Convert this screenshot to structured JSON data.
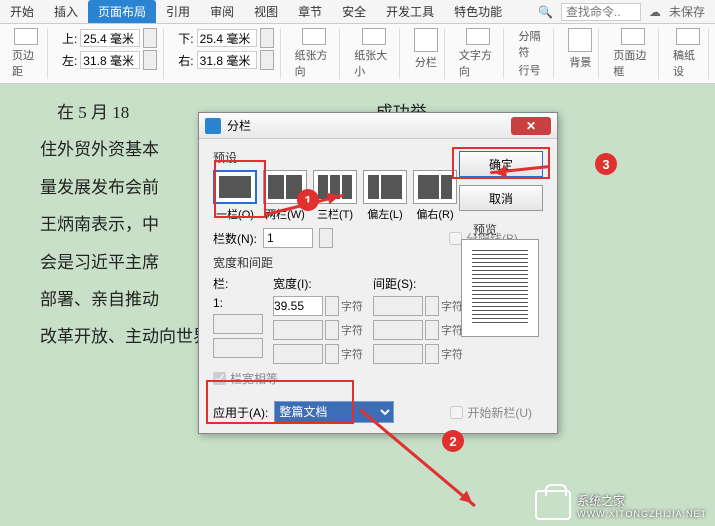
{
  "ribbon": {
    "tabs": [
      "开始",
      "插入",
      "页面布局",
      "引用",
      "审阅",
      "视图",
      "章节",
      "安全",
      "开发工具",
      "特色功能"
    ],
    "active_index": 2,
    "search_placeholder": "查找命令..",
    "unsaved": "未保存"
  },
  "toolbar": {
    "margin_label": "页边距",
    "top_label": "上:",
    "top_value": "25.4 毫米",
    "bottom_label": "下:",
    "bottom_value": "25.4 毫米",
    "left_label": "左:",
    "left_value": "31.8 毫米",
    "right_label": "右:",
    "right_value": "31.8 毫米",
    "orient": "纸张方向",
    "size": "纸张大小",
    "columns": "分栏",
    "direction": "文字方向",
    "break": "分隔符",
    "lineno": "行号",
    "background": "背景",
    "border": "页面边框",
    "manuscript": "稿纸设"
  },
  "document_text": "    在 5 月 18                                                          成功举\n住外贸外资基本                                                    外、投资\n量发展发布会前                                                    和开放\n王炳南表示，中                                                    ，综合\n会是习近平主席                                                    产生了\n部署、亲自推动                                                    的赞誉。\n改革开放、主动向世界开放市场",
  "dialog": {
    "title": "分栏",
    "preset_label": "预设",
    "presets": [
      "一栏(O)",
      "两栏(W)",
      "三栏(T)",
      "偏左(L)",
      "偏右(R)"
    ],
    "cols_label": "栏数(N):",
    "cols_value": "1",
    "divider_label": "分隔线(B)",
    "width_section": "宽度和间距",
    "col_header": "栏:",
    "width_header": "宽度(I):",
    "spacing_header": "间距(S):",
    "col1": "1:",
    "width1": "39.55",
    "unit": "字符",
    "equal_width": "栏宽相等",
    "preview_label": "预览",
    "apply_label": "应用于(A):",
    "apply_value": "整篇文档",
    "new_col_label": "开始新栏(U)",
    "ok": "确定",
    "cancel": "取消"
  },
  "annotations": {
    "n1": "1",
    "n2": "2",
    "n3": "3"
  },
  "watermark": {
    "name": "系统之家",
    "url": "WWW.XITONGZHIJIA.NET"
  }
}
